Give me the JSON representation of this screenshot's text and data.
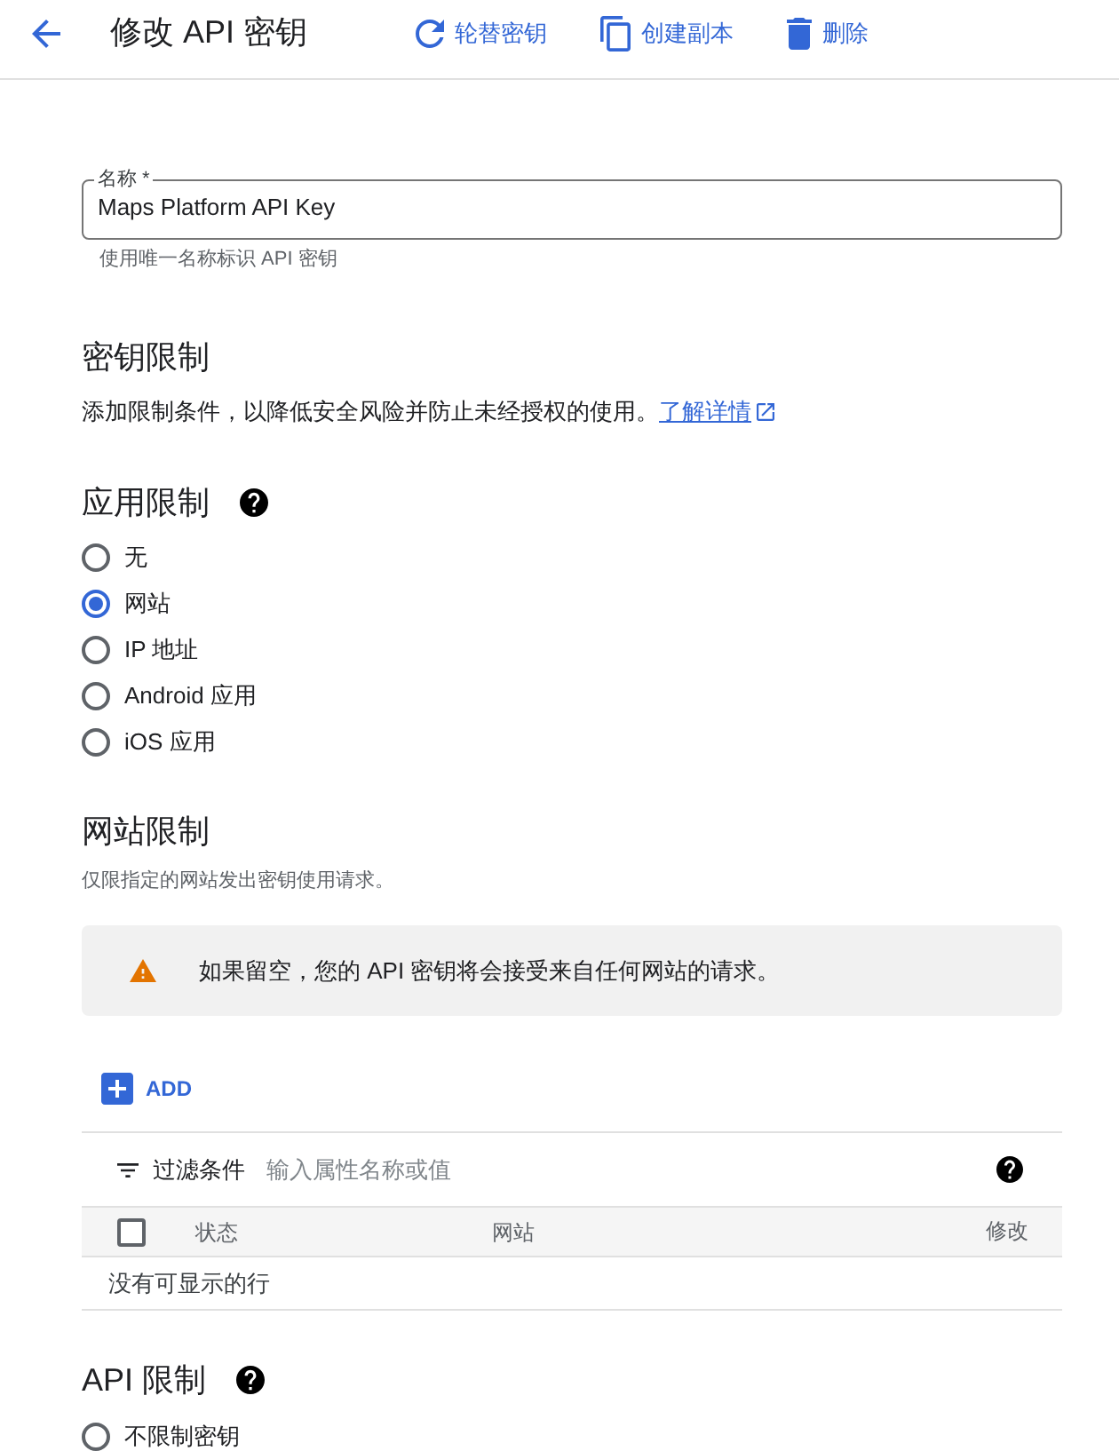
{
  "header": {
    "title": "修改 API 密钥",
    "actions": [
      {
        "kind": "rotate",
        "label": "轮替密钥"
      },
      {
        "kind": "copy",
        "label": "创建副本"
      },
      {
        "kind": "delete",
        "label": "删除"
      }
    ]
  },
  "name_field": {
    "label": "名称 *",
    "value": "Maps Platform API Key",
    "helper": "使用唯一名称标识 API 密钥"
  },
  "key_restrictions": {
    "title": "密钥限制",
    "description": "添加限制条件，以降低安全风险并防止未经授权的使用。",
    "link": "了解详情"
  },
  "application_restrictions": {
    "title": "应用限制",
    "options": [
      {
        "label": "无",
        "selected": false
      },
      {
        "label": "网站",
        "selected": true
      },
      {
        "label": "IP 地址",
        "selected": false
      },
      {
        "label": "Android 应用",
        "selected": false
      },
      {
        "label": "iOS 应用",
        "selected": false
      }
    ]
  },
  "website_restrictions": {
    "title": "网站限制",
    "description": "仅限指定的网站发出密钥使用请求。",
    "warning": "如果留空，您的 API 密钥将会接受来自任何网站的请求。",
    "add_button": "ADD",
    "filter": {
      "label": "过滤条件",
      "placeholder": "输入属性名称或值"
    },
    "table": {
      "select_all_checked": false,
      "columns": [
        "状态",
        "网站",
        "修改"
      ],
      "empty_message": "没有可显示的行"
    }
  },
  "api_restrictions": {
    "title": "API 限制",
    "options": [
      {
        "label": "不限制密钥",
        "selected": false
      }
    ]
  }
}
